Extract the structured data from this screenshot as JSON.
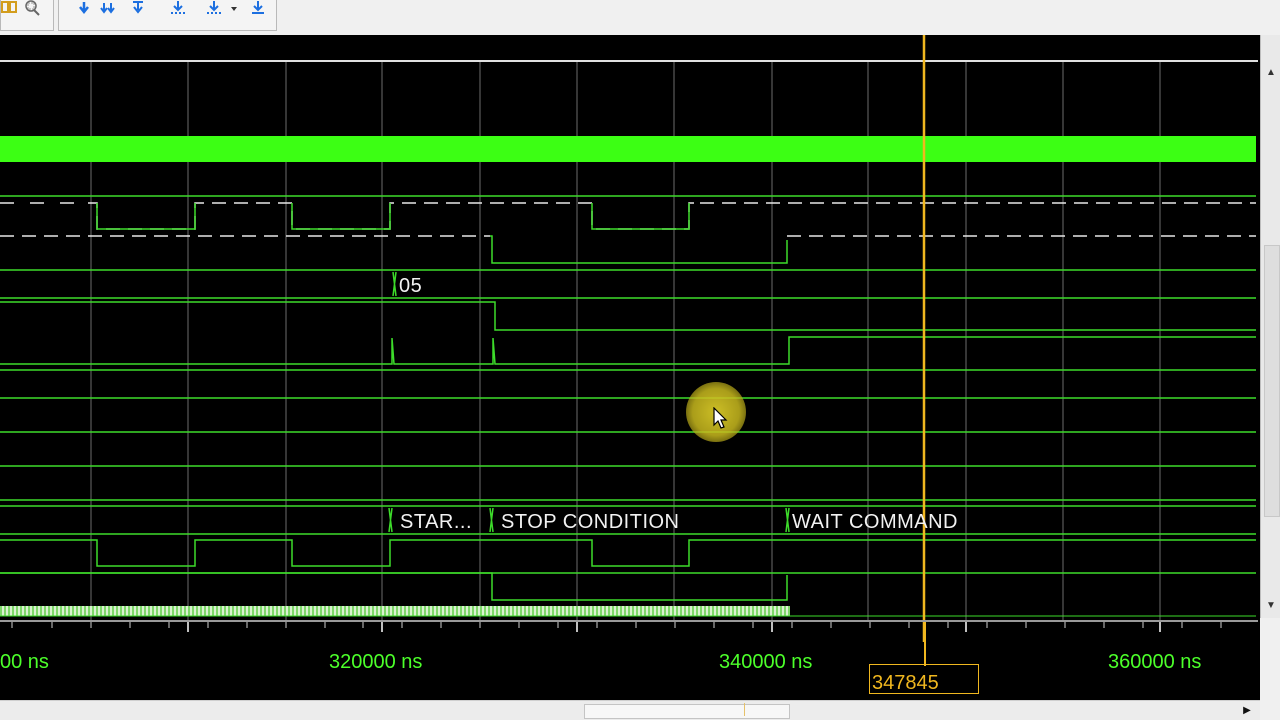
{
  "toolbar": {
    "icons": [
      "zoom-full-icon",
      "zoom-area-icon",
      "next-edge-icon",
      "previous-edge-icon",
      "next-transition-icon",
      "add-marker-icon",
      "marker-dropdown-icon",
      "go-to-marker-icon"
    ]
  },
  "waveform": {
    "bus_value_05": "05",
    "state_labels": {
      "start": "STAR...",
      "stop": "STOP  CONDITION",
      "wait": "WAIT  COMMAND"
    },
    "colors": {
      "signal": "#3ddc2a",
      "bus_bar": "#3cff14",
      "grid": "#6d6d6d",
      "cursor": "#f0b71f"
    }
  },
  "timeline": {
    "ticks": [
      "00 ns",
      "320000 ns",
      "340000 ns",
      "360000 ns"
    ],
    "cursor_value": "347845"
  }
}
